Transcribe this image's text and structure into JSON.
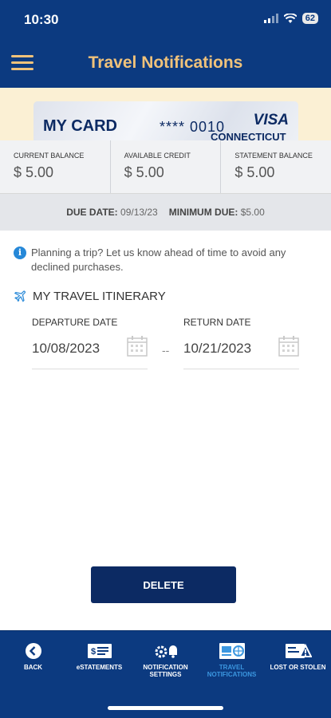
{
  "status": {
    "time": "10:30",
    "battery": "62"
  },
  "header": {
    "title": "Travel Notifications",
    "menu_icon": "hamburger-menu-icon"
  },
  "card": {
    "name": "MY CARD",
    "number": "**** 0010",
    "brand": "VISA",
    "bank": "CONNECTICUT"
  },
  "balances": [
    {
      "label": "CURRENT BALANCE",
      "value": "$ 5.00"
    },
    {
      "label": "AVAILABLE CREDIT",
      "value": "$ 5.00"
    },
    {
      "label": "STATEMENT BALANCE",
      "value": "$ 5.00"
    }
  ],
  "due": {
    "due_label": "DUE DATE:",
    "due_value": "09/13/23",
    "min_label": "MINIMUM DUE:",
    "min_value": "$5.00"
  },
  "info": {
    "text": "Planning a trip? Let us know ahead of time to avoid any declined purchases."
  },
  "itinerary": {
    "title": "MY TRAVEL ITINERARY",
    "departure_label": "DEPARTURE DATE",
    "departure_value": "10/08/2023",
    "return_label": "RETURN DATE",
    "return_value": "10/21/2023",
    "separator": "--"
  },
  "actions": {
    "delete_label": "DELETE"
  },
  "nav": [
    {
      "label": "BACK",
      "icon": "back-arrow-icon"
    },
    {
      "label": "eSTATEMENTS",
      "icon": "statement-icon"
    },
    {
      "label": "NOTIFICATION SETTINGS",
      "icon": "notification-settings-icon"
    },
    {
      "label": "TRAVEL NOTIFICATIONS",
      "icon": "travel-notification-icon",
      "active": true
    },
    {
      "label": "LOST OR STOLEN",
      "icon": "lost-stolen-icon"
    }
  ],
  "colors": {
    "primary": "#0c3a80",
    "accent": "#f0c27a",
    "button": "#0c2a63",
    "active": "#3b97e0"
  }
}
